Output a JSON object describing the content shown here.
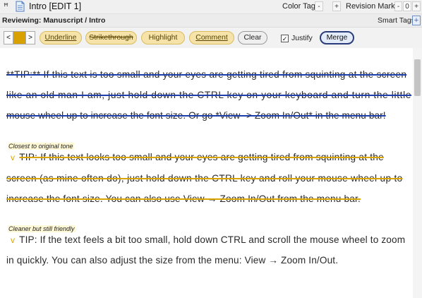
{
  "titlebar": {
    "title": "Intro [EDIT 1]",
    "color_tag_label": "Color Tag",
    "color_tag_minus": "-",
    "color_tag_plus": "+",
    "revision_marker_label": "Revision Marker",
    "revision_marker_minus": "-",
    "revision_marker_value": "0",
    "revision_marker_plus": "+"
  },
  "reviewbar": {
    "status": "Reviewing: Manuscript / Intro",
    "smart_tags_label": "Smart Tags",
    "smart_tags_plus": "+"
  },
  "toolbar": {
    "prev": "<",
    "next": ">",
    "swatch_color": "#d8a100",
    "underline": "Underline",
    "strikethrough": "Strikethrough",
    "highlight": "Highlight",
    "comment": "Comment",
    "clear": "Clear",
    "justify_checked": "✓",
    "justify_label": "Justify",
    "merge": "Merge"
  },
  "content": {
    "block1": [
      "**TIP:** If this text is too small and your eyes are getting tired from squinting at the screen",
      "like an old man I am, just hold down the CTRL key on your keyboard and turn the little",
      "mouse wheel up to increase the font size. Or go *View -> Zoom In/Out* in the menu bar!"
    ],
    "label2": "Closest to original tone",
    "caret": "v",
    "block2": [
      "TIP: If this text looks too small and your eyes are getting tired from squinting at the",
      "screen (as mine often do), just hold down the CTRL key and roll your mouse wheel up to",
      "increase the font size. You can also use View → Zoom In/Out from the menu bar."
    ],
    "label3": "Cleaner but still friendly",
    "block3": [
      "TIP: If the text feels a bit too small, hold down CTRL and scroll the mouse wheel to zoom",
      "in quickly. You can also adjust the size from the menu: View → Zoom In/Out."
    ]
  }
}
